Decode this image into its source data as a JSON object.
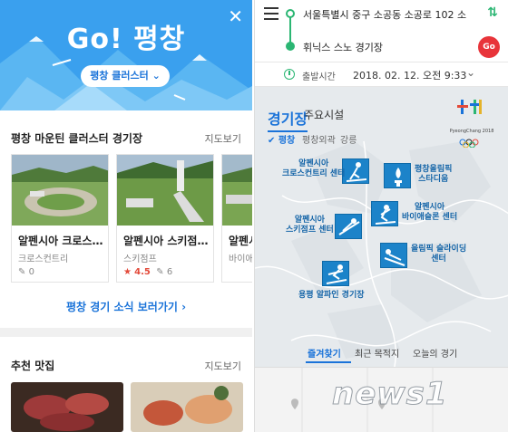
{
  "left": {
    "hero": {
      "title": "Go! 평창",
      "cluster_button": "평창 클러스터 ⌄",
      "close_icon": "close-icon",
      "color": "#3aa0ee"
    },
    "venues_section": {
      "title": "평창 마운틴 클러스터 경기장",
      "more": "지도보기",
      "cards": [
        {
          "name": "알펜시아 크로스…",
          "category": "크로스컨트리",
          "rating": "",
          "reviews": "0"
        },
        {
          "name": "알펜시아 스키점…",
          "category": "스키점프",
          "rating": "4.5",
          "reviews": "6"
        },
        {
          "name": "알펜시아",
          "category": "바이애슬",
          "rating": "",
          "reviews": ""
        }
      ],
      "news_link": "평창 경기 소식 보러가기 ›"
    },
    "food_section": {
      "title": "추천 맛집",
      "more": "지도보기"
    }
  },
  "right": {
    "route": {
      "from": "서울특별시 중구 소공동 소공로 102 소",
      "to": "휘닉스 스노 경기장",
      "go_label": "Go"
    },
    "time": {
      "label": "출발시간",
      "value": "2018. 02. 12. 오전 9:33"
    },
    "tabs": {
      "venues": "경기장",
      "facilities": "주요시설"
    },
    "subtabs": {
      "pyeongchang": "✔ 평창",
      "outskirts": "평창외곽",
      "gangneung": "강릉"
    },
    "logo_text": "PyeongChang 2018",
    "venues": [
      {
        "label": "알펜시아\n크로스컨트리 센터"
      },
      {
        "label": "평창올림픽\n스타디움"
      },
      {
        "label": "알펜시아\n스키점프 센터"
      },
      {
        "label": "알펜시아\n바이애슬론 센터"
      },
      {
        "label": "올림픽 슬라이딩\n센터"
      },
      {
        "label": "용평 알파인 경기장"
      }
    ],
    "bottom_tabs": {
      "favorites": "즐겨찾기",
      "recent": "최근 목적지",
      "today": "오늘의 경기"
    },
    "accent": "#1a73d9",
    "route_color": "#2bb673"
  },
  "watermark": "news1"
}
